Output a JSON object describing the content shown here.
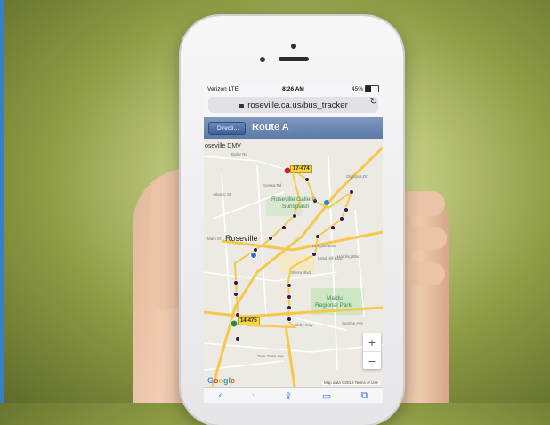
{
  "status_bar": {
    "carrier": "Verizon LTE",
    "time": "8:26 AM",
    "battery": "45%"
  },
  "browser": {
    "url": "roseville.ca.us/bus_tracker",
    "reload_icon": "reload-icon",
    "lock_icon": "lock-icon"
  },
  "nav": {
    "back_label": "Directi…",
    "title": "Route A"
  },
  "map": {
    "labels": {
      "dmv": "oseville DMV",
      "roseville": "Roseville",
      "galleria": "Roseville Galleria",
      "sunsplash": "Sunsplash",
      "maidu": "Maidu",
      "regional_park": "Regional Park",
      "main_st": "Main St",
      "douglas": "Douglas Blvd",
      "cirby": "Cirby Way",
      "eureka": "Eureka Rd",
      "sunrise": "Sunrise Ave",
      "taylor": "Taylor Rd",
      "lead_hill": "Lead Hill Blvd",
      "sierra": "Sierra Blvd",
      "olympus": "Olympus Dr",
      "harding": "Harding Blvd",
      "twin_oaks": "Twin Oaks Ave",
      "atlantic": "Atlantic St"
    },
    "bus_markers": [
      {
        "id": "17-474"
      },
      {
        "id": "14-475"
      }
    ],
    "zoom_in": "+",
    "zoom_out": "−",
    "google_logo": "Google",
    "footer": "Map data ©2019   Terms of Use",
    "route_color": "#3b1b4d",
    "road_color": "#f5c84c"
  },
  "toolbar": {
    "back": "‹",
    "forward": "›",
    "share": "⇪",
    "bookmarks": "▭",
    "tabs": "⧉"
  }
}
